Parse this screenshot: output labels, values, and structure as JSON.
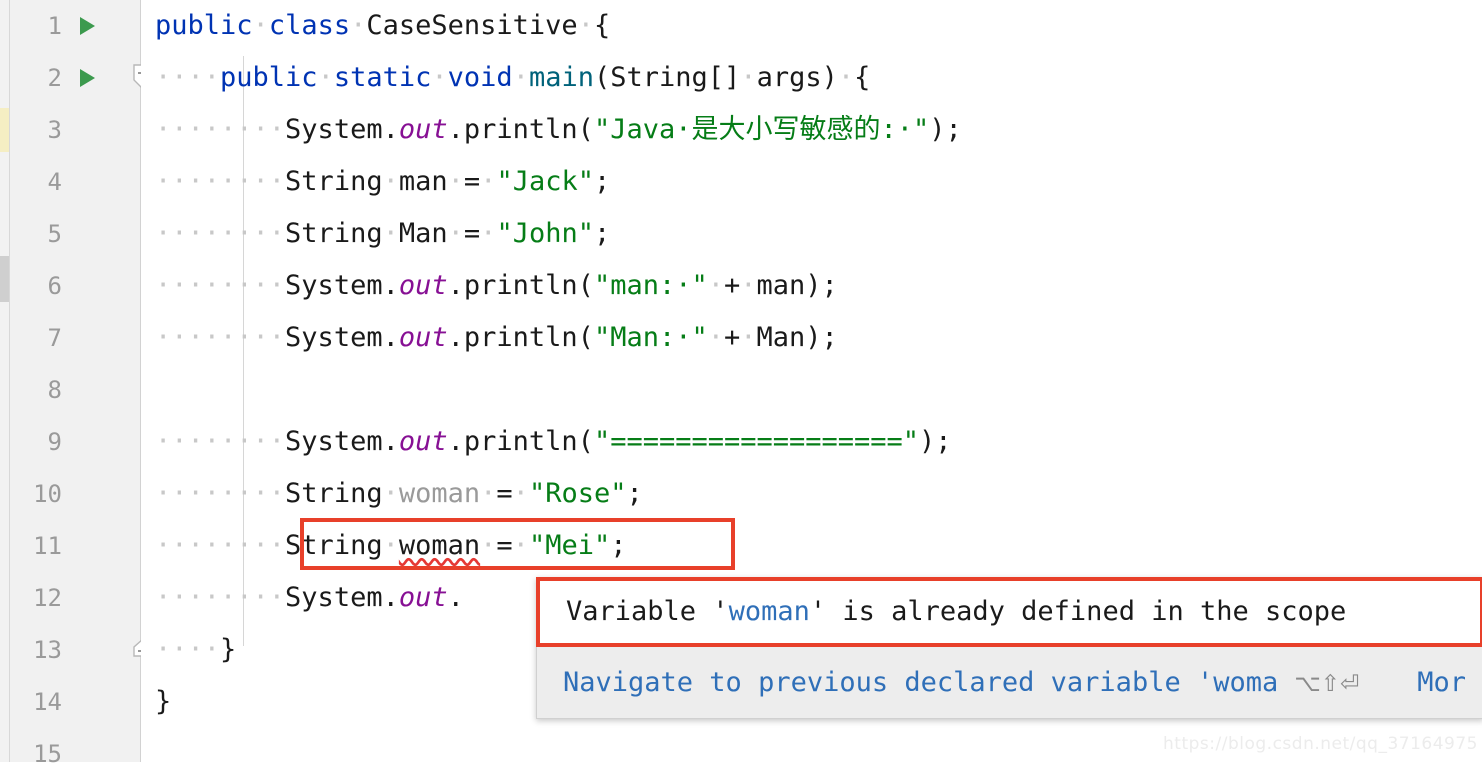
{
  "editor": {
    "app": "IntelliJ IDEA Java Editor",
    "file_class": "CaseSensitive",
    "gutter": {
      "line_numbers": [
        "1",
        "2",
        "3",
        "4",
        "5",
        "6",
        "7",
        "8",
        "9",
        "10",
        "11",
        "12",
        "13",
        "14",
        "15"
      ],
      "run_arrow_lines": [
        1,
        2
      ],
      "fold_marker_lines": [
        2,
        13
      ]
    },
    "lines": [
      {
        "n": 1,
        "text": "public class CaseSensitive {",
        "tokens": [
          {
            "t": "public",
            "c": "kw"
          },
          {
            "t": "·",
            "c": "ws"
          },
          {
            "t": "class",
            "c": "kw"
          },
          {
            "t": "·",
            "c": "ws"
          },
          {
            "t": "CaseSensitive",
            "c": "plain"
          },
          {
            "t": "·",
            "c": "ws"
          },
          {
            "t": "{",
            "c": "plain"
          }
        ]
      },
      {
        "n": 2,
        "text": "    public static void main(String[] args) {",
        "tokens": [
          {
            "t": "····",
            "c": "ws"
          },
          {
            "t": "public",
            "c": "kw"
          },
          {
            "t": "·",
            "c": "ws"
          },
          {
            "t": "static",
            "c": "kw"
          },
          {
            "t": "·",
            "c": "ws"
          },
          {
            "t": "void",
            "c": "kw"
          },
          {
            "t": "·",
            "c": "ws"
          },
          {
            "t": "main",
            "c": "method"
          },
          {
            "t": "(String[]",
            "c": "plain"
          },
          {
            "t": "·",
            "c": "ws"
          },
          {
            "t": "args)",
            "c": "plain"
          },
          {
            "t": "·",
            "c": "ws"
          },
          {
            "t": "{",
            "c": "plain"
          }
        ]
      },
      {
        "n": 3,
        "text": "        System.out.println(\"Java 是大小写敏感的: \");",
        "tokens": [
          {
            "t": "········",
            "c": "ws"
          },
          {
            "t": "System.",
            "c": "plain"
          },
          {
            "t": "out",
            "c": "field"
          },
          {
            "t": ".println(",
            "c": "plain"
          },
          {
            "t": "\"Java·是大小写敏感的:·\"",
            "c": "str"
          },
          {
            "t": ");",
            "c": "plain"
          }
        ]
      },
      {
        "n": 4,
        "text": "        String man = \"Jack\";",
        "tokens": [
          {
            "t": "········",
            "c": "ws"
          },
          {
            "t": "String",
            "c": "plain"
          },
          {
            "t": "·",
            "c": "ws"
          },
          {
            "t": "man",
            "c": "plain"
          },
          {
            "t": "·",
            "c": "ws"
          },
          {
            "t": "=",
            "c": "plain"
          },
          {
            "t": "·",
            "c": "ws"
          },
          {
            "t": "\"Jack\"",
            "c": "str"
          },
          {
            "t": ";",
            "c": "plain"
          }
        ]
      },
      {
        "n": 5,
        "text": "        String Man = \"John\";",
        "tokens": [
          {
            "t": "········",
            "c": "ws"
          },
          {
            "t": "String",
            "c": "plain"
          },
          {
            "t": "·",
            "c": "ws"
          },
          {
            "t": "Man",
            "c": "plain"
          },
          {
            "t": "·",
            "c": "ws"
          },
          {
            "t": "=",
            "c": "plain"
          },
          {
            "t": "·",
            "c": "ws"
          },
          {
            "t": "\"John\"",
            "c": "str"
          },
          {
            "t": ";",
            "c": "plain"
          }
        ]
      },
      {
        "n": 6,
        "text": "        System.out.println(\"man: \" + man);",
        "tokens": [
          {
            "t": "········",
            "c": "ws"
          },
          {
            "t": "System.",
            "c": "plain"
          },
          {
            "t": "out",
            "c": "field"
          },
          {
            "t": ".println(",
            "c": "plain"
          },
          {
            "t": "\"man:·\"",
            "c": "str"
          },
          {
            "t": "·",
            "c": "ws"
          },
          {
            "t": "+",
            "c": "plain"
          },
          {
            "t": "·",
            "c": "ws"
          },
          {
            "t": "man);",
            "c": "plain"
          }
        ]
      },
      {
        "n": 7,
        "text": "        System.out.println(\"Man: \" + Man);",
        "tokens": [
          {
            "t": "········",
            "c": "ws"
          },
          {
            "t": "System.",
            "c": "plain"
          },
          {
            "t": "out",
            "c": "field"
          },
          {
            "t": ".println(",
            "c": "plain"
          },
          {
            "t": "\"Man:·\"",
            "c": "str"
          },
          {
            "t": "·",
            "c": "ws"
          },
          {
            "t": "+",
            "c": "plain"
          },
          {
            "t": "·",
            "c": "ws"
          },
          {
            "t": "Man);",
            "c": "plain"
          }
        ]
      },
      {
        "n": 8,
        "text": "",
        "tokens": []
      },
      {
        "n": 9,
        "text": "        System.out.println(\"==================\");",
        "tokens": [
          {
            "t": "········",
            "c": "ws"
          },
          {
            "t": "System.",
            "c": "plain"
          },
          {
            "t": "out",
            "c": "field"
          },
          {
            "t": ".println(",
            "c": "plain"
          },
          {
            "t": "\"==================\"",
            "c": "str"
          },
          {
            "t": ");",
            "c": "plain"
          }
        ]
      },
      {
        "n": 10,
        "text": "        String woman = \"Rose\";",
        "tokens": [
          {
            "t": "········",
            "c": "ws"
          },
          {
            "t": "String",
            "c": "plain"
          },
          {
            "t": "·",
            "c": "ws"
          },
          {
            "t": "woman",
            "c": "unused"
          },
          {
            "t": "·",
            "c": "ws"
          },
          {
            "t": "=",
            "c": "plain"
          },
          {
            "t": "·",
            "c": "ws"
          },
          {
            "t": "\"Rose\"",
            "c": "str"
          },
          {
            "t": ";",
            "c": "plain"
          }
        ]
      },
      {
        "n": 11,
        "text": "        String woman = \"Mei\";",
        "tokens": [
          {
            "t": "········",
            "c": "ws"
          },
          {
            "t": "String",
            "c": "plain"
          },
          {
            "t": "·",
            "c": "ws"
          },
          {
            "t": "woman",
            "c": "errvar"
          },
          {
            "t": "·",
            "c": "ws"
          },
          {
            "t": "=",
            "c": "plain"
          },
          {
            "t": "·",
            "c": "ws"
          },
          {
            "t": "\"Mei\"",
            "c": "str"
          },
          {
            "t": ";",
            "c": "plain"
          }
        ]
      },
      {
        "n": 12,
        "text": "        System.out.",
        "tokens": [
          {
            "t": "········",
            "c": "ws"
          },
          {
            "t": "System.",
            "c": "plain"
          },
          {
            "t": "out",
            "c": "field"
          },
          {
            "t": ".",
            "c": "plain"
          }
        ]
      },
      {
        "n": 13,
        "text": "    }",
        "tokens": [
          {
            "t": "····",
            "c": "ws"
          },
          {
            "t": "}",
            "c": "plain"
          }
        ]
      },
      {
        "n": 14,
        "text": "}",
        "tokens": [
          {
            "t": "}",
            "c": "plain"
          }
        ]
      },
      {
        "n": 15,
        "text": "",
        "tokens": []
      }
    ]
  },
  "annotation": {
    "highlight_line": 11,
    "box_color": "#e8402a"
  },
  "tooltip": {
    "message_prefix": "Variable '",
    "message_variable": "woman",
    "message_suffix": "' is already defined in the scope",
    "action_label": "Navigate to previous declared variable 'woma",
    "action_shortcut": "⌥⇧⏎",
    "more_label": "Mor",
    "variable_color": "#2f6fb8",
    "border_color": "#e8402a"
  },
  "watermark": {
    "text": "https://blog.csdn.net/qq_37164975"
  }
}
